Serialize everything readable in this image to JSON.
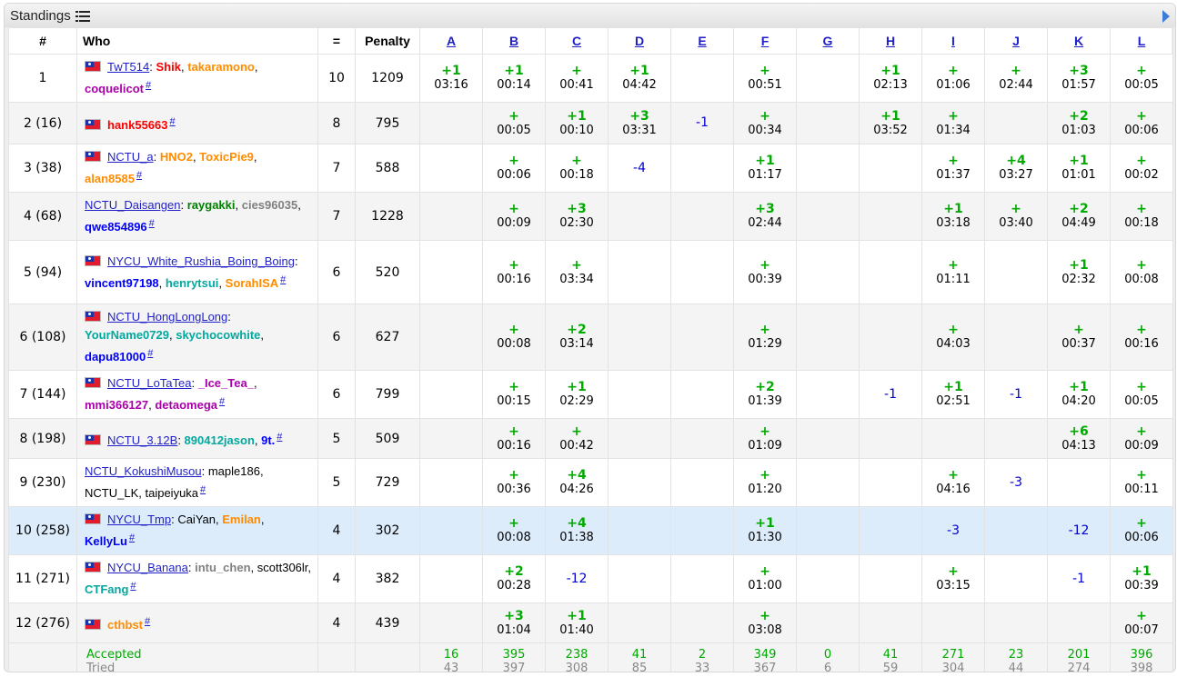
{
  "title": "Standings",
  "colors": {
    "accepted": "#00aa00",
    "rejected": "#0000cc",
    "link": "#1f1fc8",
    "highlight": "#ddecfb"
  },
  "headers": {
    "rank": "#",
    "who": "Who",
    "solved": "=",
    "penalty": "Penalty"
  },
  "problems": [
    "A",
    "B",
    "C",
    "D",
    "E",
    "F",
    "G",
    "H",
    "I",
    "J",
    "K",
    "L"
  ],
  "rows": [
    {
      "rank": "1",
      "flag": true,
      "team": "TwT514",
      "members": [
        {
          "name": "Shik",
          "color": "#ff0000"
        },
        {
          "name": "takaramono",
          "color": "#ff8c00"
        },
        {
          "name": "coquelicot",
          "color": "#aa00aa"
        }
      ],
      "solved": "10",
      "penalty": "1209",
      "cells": [
        [
          "+1",
          "03:16"
        ],
        [
          "+1",
          "00:14"
        ],
        [
          "+",
          "00:41"
        ],
        [
          "+1",
          "04:42"
        ],
        null,
        [
          "+",
          "00:51"
        ],
        null,
        [
          "+1",
          "02:13"
        ],
        [
          "+",
          "01:06"
        ],
        [
          "+",
          "02:44"
        ],
        [
          "+3",
          "01:57"
        ],
        [
          "+",
          "00:05"
        ]
      ]
    },
    {
      "rank": "2 (16)",
      "flag": true,
      "team": "",
      "members": [
        {
          "name": "hank55663",
          "color": "#ff0000"
        }
      ],
      "solved": "8",
      "penalty": "795",
      "cells": [
        null,
        [
          "+",
          "00:05"
        ],
        [
          "+1",
          "00:10"
        ],
        [
          "+3",
          "03:31"
        ],
        [
          "-1",
          null
        ],
        [
          "+",
          "00:34"
        ],
        null,
        [
          "+1",
          "03:52"
        ],
        [
          "+",
          "01:34"
        ],
        null,
        [
          "+2",
          "01:03"
        ],
        [
          "+",
          "00:06"
        ]
      ]
    },
    {
      "rank": "3 (38)",
      "flag": true,
      "team": "NCTU_a",
      "members": [
        {
          "name": "HNO2",
          "color": "#ff8c00"
        },
        {
          "name": "ToxicPie9",
          "color": "#ff8c00"
        },
        {
          "name": "alan8585",
          "color": "#ff8c00"
        }
      ],
      "solved": "7",
      "penalty": "588",
      "cells": [
        null,
        [
          "+",
          "00:06"
        ],
        [
          "+",
          "00:18"
        ],
        [
          "-4",
          null
        ],
        null,
        [
          "+1",
          "01:17"
        ],
        null,
        null,
        [
          "+",
          "01:37"
        ],
        [
          "+4",
          "03:27"
        ],
        [
          "+1",
          "01:01"
        ],
        [
          "+",
          "00:02"
        ]
      ]
    },
    {
      "rank": "4 (68)",
      "flag": false,
      "team": "NCTU_Daisangen",
      "members": [
        {
          "name": "raygakki",
          "color": "#008000"
        },
        {
          "name": "cies96035",
          "color": "#808080"
        },
        {
          "name": "qwe854896",
          "color": "#0000ff"
        }
      ],
      "solved": "7",
      "penalty": "1228",
      "cells": [
        null,
        [
          "+",
          "00:09"
        ],
        [
          "+3",
          "02:30"
        ],
        null,
        null,
        [
          "+3",
          "02:44"
        ],
        null,
        null,
        [
          "+1",
          "03:18"
        ],
        [
          "+",
          "03:40"
        ],
        [
          "+2",
          "04:49"
        ],
        [
          "+",
          "00:18"
        ]
      ]
    },
    {
      "rank": "5 (94)",
      "flag": true,
      "team": "NYCU_White_Rushia_Boing_Boing",
      "members": [
        {
          "name": "vincent97198",
          "color": "#0000ff"
        },
        {
          "name": "henrytsui",
          "color": "#03a89e"
        },
        {
          "name": "SorahISA",
          "color": "#ff8c00"
        }
      ],
      "solved": "6",
      "penalty": "520",
      "cells": [
        null,
        [
          "+",
          "00:16"
        ],
        [
          "+",
          "03:34"
        ],
        null,
        null,
        [
          "+",
          "00:39"
        ],
        null,
        null,
        [
          "+",
          "01:11"
        ],
        null,
        [
          "+1",
          "02:32"
        ],
        [
          "+",
          "00:08"
        ]
      ]
    },
    {
      "rank": "6 (108)",
      "flag": true,
      "team": "NCTU_HongLongLong",
      "members": [
        {
          "name": "YourName0729",
          "color": "#03a89e"
        },
        {
          "name": "skychocowhite",
          "color": "#03a89e"
        },
        {
          "name": "dapu81000",
          "color": "#0000ff"
        }
      ],
      "solved": "6",
      "penalty": "627",
      "cells": [
        null,
        [
          "+",
          "00:08"
        ],
        [
          "+2",
          "03:14"
        ],
        null,
        null,
        [
          "+",
          "01:29"
        ],
        null,
        null,
        [
          "+",
          "04:03"
        ],
        null,
        [
          "+",
          "00:37"
        ],
        [
          "+",
          "00:16"
        ]
      ]
    },
    {
      "rank": "7 (144)",
      "flag": true,
      "team": "NCTU_LoTaTea",
      "members": [
        {
          "name": "_Ice_Tea_",
          "color": "#aa00aa"
        },
        {
          "name": "mmi366127",
          "color": "#aa00aa"
        },
        {
          "name": "detaomega",
          "color": "#aa00aa"
        }
      ],
      "solved": "6",
      "penalty": "799",
      "cells": [
        null,
        [
          "+",
          "00:15"
        ],
        [
          "+1",
          "02:29"
        ],
        null,
        null,
        [
          "+2",
          "01:39"
        ],
        null,
        [
          "-1",
          null
        ],
        [
          "+1",
          "02:51"
        ],
        [
          "-1",
          null
        ],
        [
          "+1",
          "04:20"
        ],
        [
          "+",
          "00:05"
        ]
      ]
    },
    {
      "rank": "8 (198)",
      "flag": true,
      "team": "NCTU_3.12B",
      "members": [
        {
          "name": "890412jason",
          "color": "#03a89e"
        },
        {
          "name": "9t.",
          "color": "#0000ff"
        }
      ],
      "solved": "5",
      "penalty": "509",
      "cells": [
        null,
        [
          "+",
          "00:16"
        ],
        [
          "+",
          "00:42"
        ],
        null,
        null,
        [
          "+",
          "01:09"
        ],
        null,
        null,
        null,
        null,
        [
          "+6",
          "04:13"
        ],
        [
          "+",
          "00:09"
        ]
      ]
    },
    {
      "rank": "9 (230)",
      "flag": false,
      "team": "NCTU_KokushiMusou",
      "members": [
        {
          "name": "maple186",
          "color": "#000000",
          "plain": true
        },
        {
          "name": "NCTU_LK",
          "color": "#000000",
          "plain": true
        },
        {
          "name": "taipeiyuka",
          "color": "#000000",
          "plain": true
        }
      ],
      "solved": "5",
      "penalty": "729",
      "cells": [
        null,
        [
          "+",
          "00:36"
        ],
        [
          "+4",
          "04:26"
        ],
        null,
        null,
        [
          "+",
          "01:20"
        ],
        null,
        null,
        [
          "+",
          "04:16"
        ],
        [
          "-3",
          null
        ],
        null,
        [
          "+",
          "00:11"
        ]
      ]
    },
    {
      "rank": "10 (258)",
      "flag": true,
      "hl": true,
      "team": "NYCU_Tmp",
      "members": [
        {
          "name": "CaiYan",
          "color": "#000000",
          "plain": true
        },
        {
          "name": "Emilan",
          "color": "#ff8c00"
        },
        {
          "name": "KellyLu",
          "color": "#0000ff"
        }
      ],
      "solved": "4",
      "penalty": "302",
      "cells": [
        null,
        [
          "+",
          "00:08"
        ],
        [
          "+4",
          "01:38"
        ],
        null,
        null,
        [
          "+1",
          "01:30"
        ],
        null,
        null,
        [
          "-3",
          null
        ],
        null,
        [
          "-12",
          null
        ],
        [
          "+",
          "00:06"
        ]
      ]
    },
    {
      "rank": "11 (271)",
      "flag": true,
      "team": "NYCU_Banana",
      "members": [
        {
          "name": "intu_chen",
          "color": "#808080"
        },
        {
          "name": "scott306lr",
          "color": "#000000",
          "plain": true
        },
        {
          "name": "CTFang",
          "color": "#03a89e"
        }
      ],
      "solved": "4",
      "penalty": "382",
      "cells": [
        null,
        [
          "+2",
          "00:28"
        ],
        [
          "-12",
          null
        ],
        null,
        null,
        [
          "+",
          "01:00"
        ],
        null,
        null,
        [
          "+",
          "03:15"
        ],
        null,
        [
          "-1",
          null
        ],
        [
          "+1",
          "00:39"
        ]
      ]
    },
    {
      "rank": "12 (276)",
      "flag": true,
      "team": "",
      "members": [
        {
          "name": "cthbst",
          "color": "#ff8c00"
        }
      ],
      "solved": "4",
      "penalty": "439",
      "cells": [
        null,
        [
          "+3",
          "01:04"
        ],
        [
          "+1",
          "01:40"
        ],
        null,
        null,
        [
          "+",
          "03:08"
        ],
        null,
        null,
        null,
        null,
        null,
        [
          "+",
          "00:07"
        ]
      ]
    }
  ],
  "stats": {
    "accepted_label": "Accepted",
    "tried_label": "Tried",
    "accepted": [
      "16",
      "395",
      "238",
      "41",
      "2",
      "349",
      "0",
      "41",
      "271",
      "23",
      "201",
      "396"
    ],
    "tried": [
      "43",
      "397",
      "308",
      "85",
      "33",
      "367",
      "6",
      "59",
      "304",
      "44",
      "274",
      "398"
    ]
  }
}
